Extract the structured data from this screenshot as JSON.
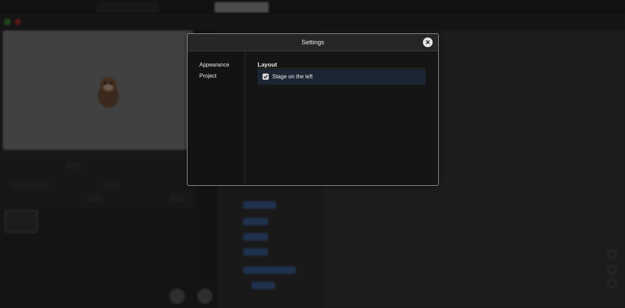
{
  "modal": {
    "title": "Settings",
    "close_icon": "close-icon",
    "sidebar": {
      "items": [
        {
          "label": "Appearance"
        },
        {
          "label": "Project"
        }
      ]
    },
    "section": {
      "title": "Layout",
      "options": [
        {
          "label": "Stage on the left",
          "checked": true
        }
      ]
    }
  },
  "colors": {
    "modal_bg": "#151515",
    "option_highlight": "#1c2533",
    "checkbox": "#d8d8d8"
  }
}
